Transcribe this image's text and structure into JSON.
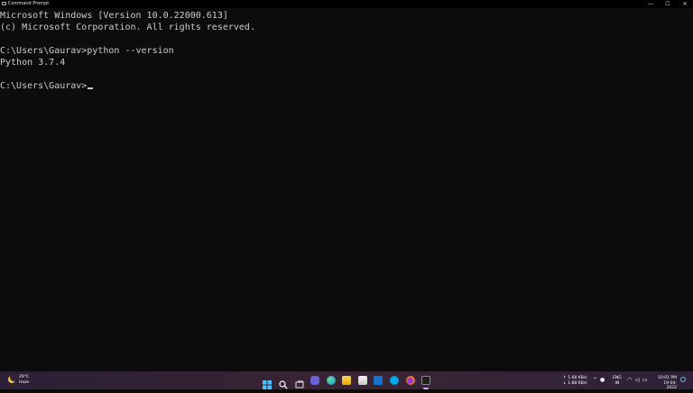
{
  "window": {
    "title": "Command Prompt",
    "minimize": "—",
    "maximize": "☐",
    "close": "✕"
  },
  "console": {
    "lines": [
      "Microsoft Windows [Version 10.0.22000.613]",
      "(c) Microsoft Corporation. All rights reserved.",
      "",
      "C:\\Users\\Gaurav>python --version",
      "Python 3.7.4",
      "",
      "C:\\Users\\Gaurav>"
    ]
  },
  "taskbar": {
    "weather": {
      "temp": "29°C",
      "condition": "Haze"
    },
    "apps": [
      "windows-start-icon",
      "search-icon",
      "task-view-icon",
      "chat-icon",
      "edge-icon",
      "file-explorer-icon",
      "store-icon",
      "mail-icon",
      "skype-icon",
      "firefox-icon",
      "terminal-icon"
    ],
    "network": {
      "up": "↑ 1.68 KB/s",
      "down": "↓ 1.88 KB/s"
    },
    "lang": {
      "code": "ENG",
      "region": "IN"
    },
    "clock": {
      "time": "10:01 PM",
      "date": "19-04-2022"
    }
  }
}
